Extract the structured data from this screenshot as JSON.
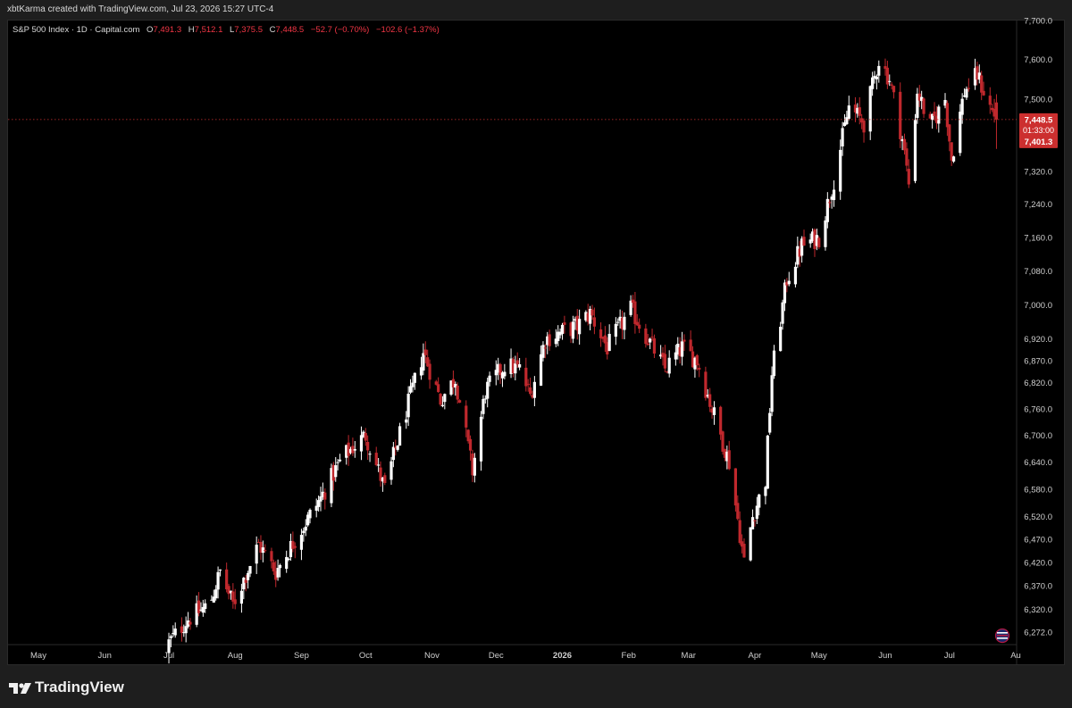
{
  "header": {
    "credit": "xbtKarma created with TradingView.com, Jul 23, 2026 15:27 UTC-4"
  },
  "legend": {
    "symbol": "S&P 500 Index · 1D · Capital.com",
    "open_label": "O",
    "open": "7,491.3",
    "high_label": "H",
    "high": "7,512.1",
    "low_label": "L",
    "low": "7,375.5",
    "close_label": "C",
    "close": "7,448.5",
    "change": "−52.7 (−0.70%)",
    "change2": "−102.6 (−1.37%)"
  },
  "price_badge": {
    "last": "7,448.5",
    "countdown": "01:33:00",
    "low": "7,401.3",
    "color": "#cc2f2f"
  },
  "footer": {
    "brand": "TradingView"
  },
  "colors": {
    "up": "#ffffff",
    "down": "#c0282d",
    "background": "#000000"
  },
  "icons": {
    "logo": "tradingview-logo-icon",
    "flag": "us-flag-icon"
  },
  "chart_data": {
    "type": "candlestick",
    "title": "S&P 500 Index · 1D · Capital.com",
    "x_axis_labels": [
      "May",
      "Jun",
      "Jul",
      "Aug",
      "Sep",
      "Oct",
      "Nov",
      "Dec",
      "2026",
      "Feb",
      "Mar",
      "Apr",
      "May",
      "Jun",
      "Jul",
      "Au"
    ],
    "y_axis_labels": [
      "7,700.0",
      "7,600.0",
      "7,500.0",
      "7,400.0",
      "7,320.0",
      "7,240.0",
      "7,160.0",
      "7,080.0",
      "7,000.0",
      "6,920.0",
      "6,870.0",
      "6,820.0",
      "6,760.0",
      "6,700.0",
      "6,640.0",
      "6,580.0",
      "6,520.0",
      "6,470.0",
      "6,420.0",
      "6,370.0",
      "6,320.0",
      "6,272.0"
    ],
    "y_scale": "log",
    "current_price_line": 7448.5,
    "anchors": [
      {
        "date": "2025-07-01",
        "close": 6250
      },
      {
        "date": "2025-07-10",
        "close": 6300
      },
      {
        "date": "2025-07-20",
        "close": 6330
      },
      {
        "date": "2025-07-25",
        "close": 6400
      },
      {
        "date": "2025-07-31",
        "close": 6330
      },
      {
        "date": "2025-08-12",
        "close": 6460
      },
      {
        "date": "2025-08-20",
        "close": 6400
      },
      {
        "date": "2025-08-29",
        "close": 6470
      },
      {
        "date": "2025-09-10",
        "close": 6560
      },
      {
        "date": "2025-09-20",
        "close": 6650
      },
      {
        "date": "2025-10-01",
        "close": 6700
      },
      {
        "date": "2025-10-10",
        "close": 6580
      },
      {
        "date": "2025-10-15",
        "close": 6670
      },
      {
        "date": "2025-10-28",
        "close": 6890
      },
      {
        "date": "2025-11-05",
        "close": 6780
      },
      {
        "date": "2025-11-12",
        "close": 6830
      },
      {
        "date": "2025-11-20",
        "close": 6620
      },
      {
        "date": "2025-11-26",
        "close": 6800
      },
      {
        "date": "2025-12-05",
        "close": 6860
      },
      {
        "date": "2025-12-12",
        "close": 6850
      },
      {
        "date": "2025-12-17",
        "close": 6790
      },
      {
        "date": "2025-12-24",
        "close": 6920
      },
      {
        "date": "2026-01-08",
        "close": 6950
      },
      {
        "date": "2026-01-14",
        "close": 6980
      },
      {
        "date": "2026-01-22",
        "close": 6900
      },
      {
        "date": "2026-02-02",
        "close": 6990
      },
      {
        "date": "2026-02-10",
        "close": 6920
      },
      {
        "date": "2026-02-18",
        "close": 6850
      },
      {
        "date": "2026-02-26",
        "close": 6900
      },
      {
        "date": "2026-03-05",
        "close": 6870
      },
      {
        "date": "2026-03-12",
        "close": 6760
      },
      {
        "date": "2026-03-20",
        "close": 6640
      },
      {
        "date": "2026-03-27",
        "close": 6420
      },
      {
        "date": "2026-03-31",
        "close": 6520
      },
      {
        "date": "2026-04-06",
        "close": 6600
      },
      {
        "date": "2026-04-09",
        "close": 6840
      },
      {
        "date": "2026-04-16",
        "close": 7060
      },
      {
        "date": "2026-04-23",
        "close": 7140
      },
      {
        "date": "2026-05-01",
        "close": 7160
      },
      {
        "date": "2026-05-08",
        "close": 7300
      },
      {
        "date": "2026-05-15",
        "close": 7480
      },
      {
        "date": "2026-05-22",
        "close": 7440
      },
      {
        "date": "2026-05-29",
        "close": 7600
      },
      {
        "date": "2026-06-03",
        "close": 7550
      },
      {
        "date": "2026-06-09",
        "close": 7400
      },
      {
        "date": "2026-06-12",
        "close": 7290
      },
      {
        "date": "2026-06-16",
        "close": 7520
      },
      {
        "date": "2026-06-22",
        "close": 7430
      },
      {
        "date": "2026-06-29",
        "close": 7500
      },
      {
        "date": "2026-07-02",
        "close": 7350
      },
      {
        "date": "2026-07-08",
        "close": 7520
      },
      {
        "date": "2026-07-14",
        "close": 7560
      },
      {
        "date": "2026-07-20",
        "close": 7480
      },
      {
        "date": "2026-07-23",
        "close": 7448.5
      }
    ]
  }
}
